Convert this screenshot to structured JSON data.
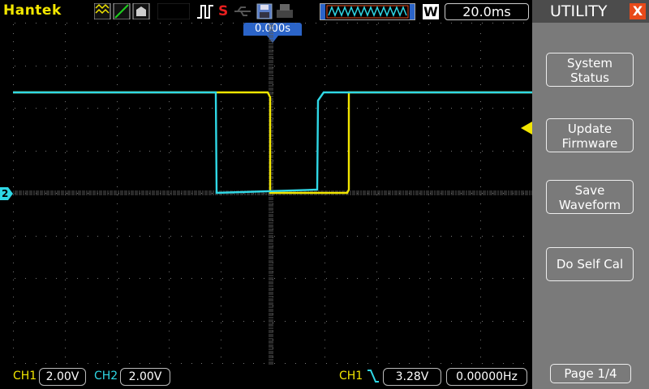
{
  "brand": "Hantek",
  "topbar": {
    "timebase": "20.0ms",
    "window_label": "W",
    "run_state_letter": "S"
  },
  "trigger_position": "0.000s",
  "colors": {
    "ch1": "#f2e600",
    "ch2": "#2fd8e6",
    "accent": "#2b64c8",
    "menu_bg": "#7a7a7a"
  },
  "menu": {
    "title": "UTILITY",
    "close_label": "X",
    "items": [
      {
        "label": "System\nStatus"
      },
      {
        "label": "Update\nFirmware"
      },
      {
        "label": "Save\nWaveform"
      },
      {
        "label": "Do Self Cal"
      }
    ],
    "page": "Page 1/4"
  },
  "status": {
    "ch1_label": "CH1",
    "ch1_scale": "2.00V",
    "ch2_label": "CH2",
    "ch2_scale": "2.00V",
    "trig_source": "CH1",
    "trig_level": "3.28V",
    "frequency": "0.00000Hz"
  },
  "ch2_marker": "2"
}
